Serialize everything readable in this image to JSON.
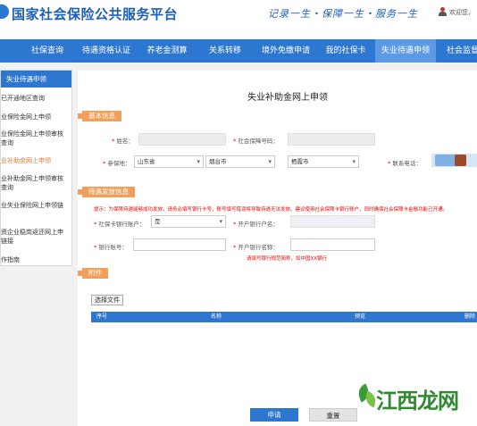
{
  "header": {
    "site_title": "国家社会保险公共服务平台",
    "slogan": "记录一生・保障一生・服务一生",
    "welcome": "欢迎您，"
  },
  "nav": {
    "items": [
      {
        "label": "社保查询"
      },
      {
        "label": "待遇资格认证"
      },
      {
        "label": "养老金测算"
      },
      {
        "label": "关系转移"
      },
      {
        "label": "境外免缴申请"
      },
      {
        "label": "我的社保卡"
      },
      {
        "label": "失业待遇申领"
      },
      {
        "label": "社会监督"
      }
    ],
    "active_index": 6
  },
  "sidebar": {
    "title": "失业待遇申领",
    "items": [
      {
        "label": "已开通地区查询"
      },
      {
        "label": "业保险金网上申领"
      },
      {
        "label": "业保险金网上申领审核",
        "label2": "查询"
      },
      {
        "label": "业补助金网上申领"
      },
      {
        "label": "业补助金网上申领审核",
        "label2": "查询"
      },
      {
        "label": "业失业保险网上申领链"
      },
      {
        "label": "资企业稳岗返还网上申",
        "label2": "链接"
      },
      {
        "label": "作指南"
      }
    ],
    "active_index": 3
  },
  "form": {
    "page_title": "失业补助金网上申领",
    "section_basic": "基本信息",
    "section_payment": "待遇发放信息",
    "section_attachment": "附件",
    "name_label": "姓名：",
    "ssn_label": "社会保障号码：",
    "insured_place_label": "参保地：",
    "province": "山东省",
    "city": "烟台市",
    "district": "栖霞市",
    "phone_label": "联系电话：",
    "notice": "提示：为保障待遇能够成功发放，请务必填写银行卡号，账号填写错误将导致待遇无法发放。建议使用社会保障卡银行账户，同时确保社会保障卡金融功能已开通。",
    "card_account_label": "社保卡银行账户：",
    "card_account_value": "是",
    "bank_name_label": "开户银行户名：",
    "bank_account_label": "银行账号：",
    "bank_branch_label": "开户银行名称：",
    "bank_hint": "请填写银行规范简称，如中国XX银行",
    "choose_file": "选择文件",
    "table_headers": [
      "序号",
      "名称",
      "预览",
      "删除"
    ],
    "submit": "申请",
    "reset": "重置"
  },
  "watermark": {
    "text": "江西龙网"
  }
}
